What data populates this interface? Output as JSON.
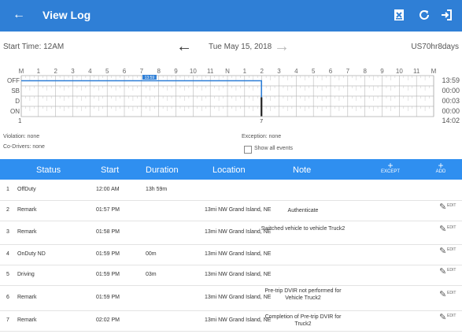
{
  "appbar": {
    "back": "←",
    "title": "View Log",
    "colors": {
      "bar": "#2f7fd6",
      "header": "#2f8ff0"
    }
  },
  "subheader": {
    "start_time": "Start Time: 12AM",
    "date": "Tue May 15, 2018",
    "rule": "US70hr8days",
    "prev": "←",
    "next": "→"
  },
  "graph": {
    "hour_labels": [
      "M",
      "1",
      "2",
      "3",
      "4",
      "5",
      "6",
      "7",
      "8",
      "9",
      "10",
      "11",
      "N",
      "1",
      "2",
      "3",
      "4",
      "5",
      "6",
      "7",
      "8",
      "9",
      "10",
      "11",
      "M"
    ],
    "rows": [
      "OFF",
      "SB",
      "D",
      "ON"
    ],
    "totals": [
      "13:59",
      "00:00",
      "00:03",
      "00:00"
    ],
    "grand_total": "14:02",
    "start_marker": "1",
    "end_marker": "7",
    "badge": "13:59"
  },
  "info": {
    "violation": "Violation: none",
    "exception": "Exception: none",
    "codrivers": "Co-Drivers: none",
    "show_all": "Show all events"
  },
  "table": {
    "columns": {
      "status": "Status",
      "start": "Start",
      "duration": "Duration",
      "location": "Location",
      "note": "Note"
    },
    "except_label": "EXCEPT",
    "add_label": "ADD",
    "edit_label": "EDIT",
    "rows": [
      {
        "num": "1",
        "status": "OffDuty",
        "start": "12:00 AM",
        "duration": "13h 59m",
        "location": "",
        "note": "",
        "edit": false
      },
      {
        "num": "2",
        "status": "Remark",
        "start": "01:57 PM",
        "duration": "",
        "location": "13mi NW Grand Island, NE",
        "note": "Authenticate",
        "edit": true
      },
      {
        "num": "3",
        "status": "Remark",
        "start": "01:58 PM",
        "duration": "",
        "location": "13mi NW Grand Island, NE",
        "note": "Switched vehicle to vehicle Truck2",
        "edit": true
      },
      {
        "num": "4",
        "status": "OnDuty ND",
        "start": "01:59 PM",
        "duration": "00m",
        "location": "13mi NW Grand Island, NE",
        "note": "",
        "edit": true
      },
      {
        "num": "5",
        "status": "Driving",
        "start": "01:59 PM",
        "duration": "03m",
        "location": "13mi NW Grand Island, NE",
        "note": "",
        "edit": true
      },
      {
        "num": "6",
        "status": "Remark",
        "start": "01:59 PM",
        "duration": "",
        "location": "13mi NW Grand Island, NE",
        "note": "Pre-trip DVIR not performed for Vehicle Truck2",
        "edit": true
      },
      {
        "num": "7",
        "status": "Remark",
        "start": "02:02 PM",
        "duration": "",
        "location": "13mi NW Grand Island, NE",
        "note": "Completion of Pre-trip DVIR for Truck2",
        "edit": true
      }
    ]
  }
}
